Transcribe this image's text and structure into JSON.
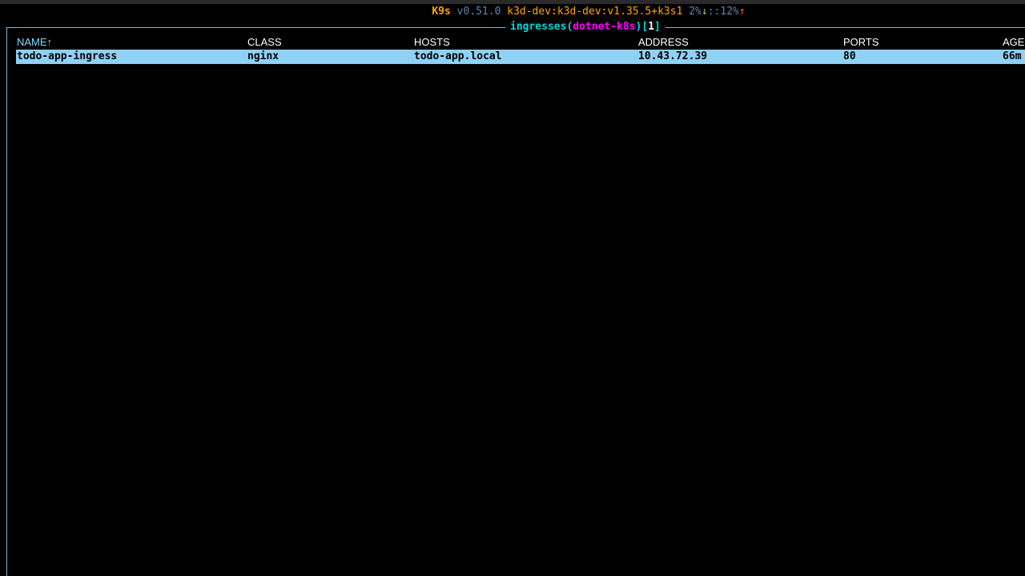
{
  "status": {
    "app": "K9s",
    "version": "v0.51.0",
    "context": "k3d-dev:k3d-dev:v1.35.5+k3s1",
    "cpu": "2%",
    "cpu_arrow": "↓",
    "separator": "::",
    "mem": "12%",
    "mem_arrow": "↑"
  },
  "view": {
    "resource": "ingresses",
    "namespace": "dotnet-k8s",
    "count": "1",
    "open_paren": "(",
    "close_paren": ")",
    "open_bracket": "[",
    "close_bracket": "]"
  },
  "table": {
    "headers": {
      "name": "NAME↑",
      "class": "CLASS",
      "hosts": "HOSTS",
      "address": "ADDRESS",
      "ports": "PORTS",
      "age": "AGE"
    },
    "rows": [
      {
        "name": "todo-app-ingress",
        "class": "nginx",
        "hosts": "todo-app.local",
        "address": "10.43.72.39",
        "ports": "80",
        "age": "66m"
      }
    ]
  },
  "colors": {
    "background": "#000000",
    "selected_row": "#8fd0f5",
    "border": "#7eb6ce",
    "logo": "#ffa500",
    "resource": "#00d7d7",
    "namespace": "#ff00ff"
  }
}
